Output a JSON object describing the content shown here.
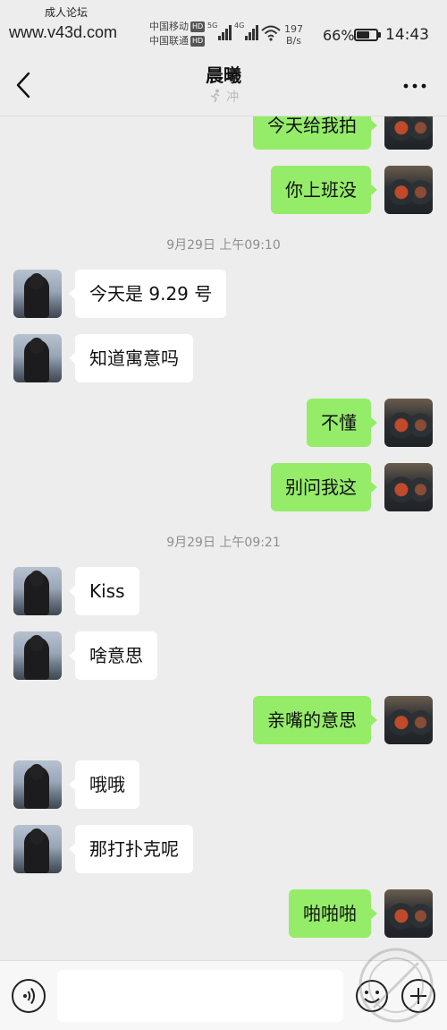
{
  "statusbar": {
    "watermark_top": "成人论坛",
    "watermark_url": "www.v43d.com",
    "carrier1": "中国移动",
    "carrier2": "中国联通",
    "hd": "HD",
    "sig1_tag": "5G",
    "sig2_tag": "4G",
    "net_speed": "197",
    "net_unit": "B/s",
    "battery_pct": "66%",
    "battery_level": 0.66,
    "time": "14:43"
  },
  "header": {
    "title": "晨曦",
    "subtitle": "冲",
    "back_icon": "chevron-left-icon",
    "more_icon": "more-dots-icon"
  },
  "messages": [
    {
      "type": "msg",
      "side": "right",
      "text": "今天给我拍"
    },
    {
      "type": "msg",
      "side": "right",
      "text": "你上班没"
    },
    {
      "type": "time",
      "text": "9月29日 上午09:10"
    },
    {
      "type": "msg",
      "side": "left",
      "text": "今天是 9.29 号"
    },
    {
      "type": "msg",
      "side": "left",
      "text": "知道寓意吗"
    },
    {
      "type": "msg",
      "side": "right",
      "text": "不懂"
    },
    {
      "type": "msg",
      "side": "right",
      "text": "别问我这"
    },
    {
      "type": "time",
      "text": "9月29日 上午09:21"
    },
    {
      "type": "msg",
      "side": "left",
      "text": "Kiss"
    },
    {
      "type": "msg",
      "side": "left",
      "text": "啥意思"
    },
    {
      "type": "msg",
      "side": "right",
      "text": "亲嘴的意思"
    },
    {
      "type": "msg",
      "side": "left",
      "text": "哦哦"
    },
    {
      "type": "msg",
      "side": "left",
      "text": "那打扑克呢"
    },
    {
      "type": "msg",
      "side": "right",
      "text": "啪啪啪"
    }
  ],
  "bottombar": {
    "voice_icon": "voice-icon",
    "input_value": "",
    "emoji_icon": "emoji-icon",
    "plus_icon": "plus-icon"
  },
  "colors": {
    "background": "#ededed",
    "bubble_sent": "#95ec69",
    "bubble_received": "#ffffff",
    "timestamp": "#8e8e8e"
  }
}
